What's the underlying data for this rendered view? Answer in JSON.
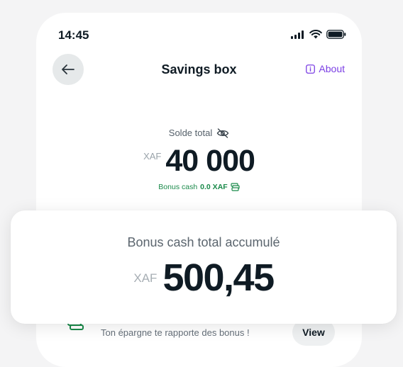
{
  "status_bar": {
    "time": "14:45"
  },
  "header": {
    "title": "Savings box",
    "about_label": "About"
  },
  "balance": {
    "label": "Solde total",
    "currency": "XAF",
    "amount": "40 000",
    "bonus_label": "Bonus cash",
    "bonus_value": "0.0 XAF"
  },
  "promo_row": {
    "text": "Ton épargne te rapporte des bonus !",
    "button_label": "View"
  },
  "bonus_sheet": {
    "label": "Bonus cash total accumulé",
    "currency": "XAF",
    "amount": "500,45"
  },
  "colors": {
    "accent": "#7b3fe4",
    "bonus_green": "#1a8a4a",
    "text_dark": "#0f1b24"
  }
}
